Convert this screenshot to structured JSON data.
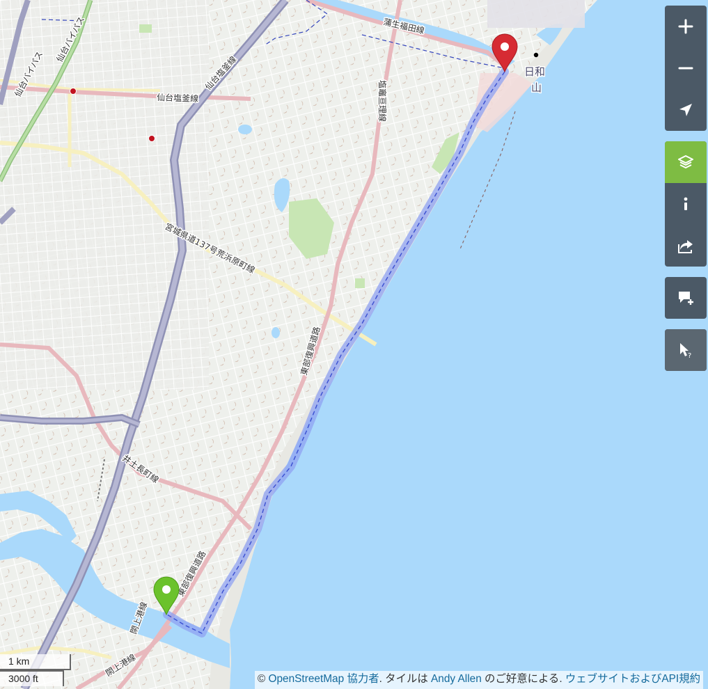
{
  "map": {
    "road_labels": [
      "蒲生福田線",
      "仙台塩釜線",
      "仙台バイパス",
      "仙台バイパス",
      "仙台塩釜線",
      "宮城県道137号荒浜原町線",
      "東部復興道路",
      "井土長町線",
      "東部復興道路",
      "閖上港線",
      "塩竈亘理線",
      "閖上港線"
    ],
    "poi_labels": [
      "日和",
      "山"
    ],
    "start_marker": "green-start-pin",
    "end_marker": "red-end-pin",
    "route_color": "#6b7fe8",
    "sea_color": "#aad9fb",
    "land_color": "#eef0ec"
  },
  "controls": {
    "zoom_in_icon": "plus-icon",
    "zoom_out_icon": "minus-icon",
    "locate_icon": "navigation-arrow-icon",
    "layers_icon": "layers-icon",
    "info_icon": "info-icon",
    "share_icon": "share-icon",
    "note_icon": "add-note-icon",
    "query_icon": "query-features-icon",
    "accent_color": "#7ebc43",
    "panel_color": "#4b5966"
  },
  "scale": {
    "metric": "1 km",
    "imperial": "3000 ft"
  },
  "attribution": {
    "copyright": "©",
    "osm_link": "OpenStreetMap 協力者",
    "mid_text": ". タイルは",
    "author_link": "Andy Allen",
    "tail_text": "のご好意による.",
    "terms_link": "ウェブサイトおよびAPI規約"
  }
}
